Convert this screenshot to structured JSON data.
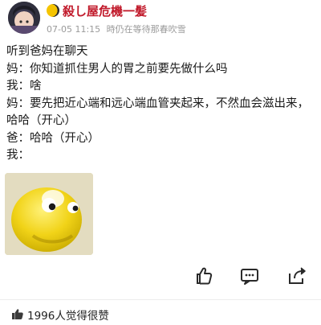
{
  "post": {
    "username": "殺し屋危機一髪",
    "date": "07-05 11:15",
    "device_text": "時仍在等待那春吹雪",
    "lines": [
      "听到爸妈在聊天",
      "妈：你知道抓住男人的胃之前要先做什么吗",
      "我：啥",
      "妈：要先把近心端和远心端血管夹起来，不然血会滋出来，哈哈（开心）",
      "爸：哈哈（开心）",
      "我："
    ]
  },
  "footer": {
    "likes_text": "1996人觉得很赞"
  },
  "icons": {
    "moon": "crescent-moon-icon",
    "like": "thumbs-up-icon",
    "comment": "comment-icon",
    "share": "share-icon"
  },
  "colors": {
    "username": "#c11a2b",
    "meta": "#9a9a9a",
    "sticker": "#f1d318"
  }
}
